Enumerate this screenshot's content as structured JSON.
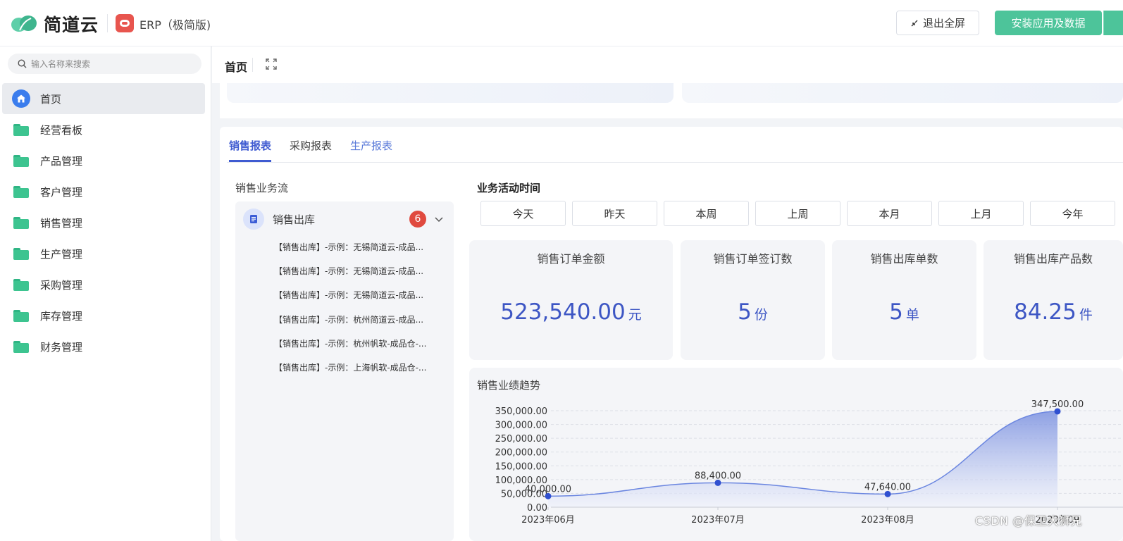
{
  "brand": {
    "name": "简道云",
    "app_name": "ERP（极简版)"
  },
  "header": {
    "exit_fullscreen_label": "退出全屏",
    "install_label": "安装应用及数据"
  },
  "sidebar": {
    "search_placeholder": "输入名称来搜索",
    "items": [
      {
        "label": "首页",
        "icon": "home-icon",
        "active": true
      },
      {
        "label": "经营看板",
        "icon": "folder-icon"
      },
      {
        "label": "产品管理",
        "icon": "folder-icon"
      },
      {
        "label": "客户管理",
        "icon": "folder-icon"
      },
      {
        "label": "销售管理",
        "icon": "folder-icon"
      },
      {
        "label": "生产管理",
        "icon": "folder-icon"
      },
      {
        "label": "采购管理",
        "icon": "folder-icon"
      },
      {
        "label": "库存管理",
        "icon": "folder-icon"
      },
      {
        "label": "财务管理",
        "icon": "folder-icon"
      }
    ]
  },
  "page": {
    "breadcrumb": "首页"
  },
  "tabs": [
    {
      "label": "销售报表",
      "active": true
    },
    {
      "label": "采购报表"
    },
    {
      "label": "生产报表"
    }
  ],
  "flow": {
    "title": "销售业务流",
    "node_name": "销售出库",
    "badge_count": "6",
    "items": [
      "【销售出库】-示例：无锡简道云-成品...",
      "【销售出库】-示例：无锡简道云-成品...",
      "【销售出库】-示例：无锡简道云-成品...",
      "【销售出库】-示例：杭州简道云-成品...",
      "【销售出库】-示例：杭州帆软-成品仓-...",
      "【销售出库】-示例：上海帆软-成品仓-..."
    ]
  },
  "activity": {
    "title": "业务活动时间",
    "periods": [
      "今天",
      "昨天",
      "本周",
      "上周",
      "本月",
      "上月",
      "今年"
    ]
  },
  "kpis": [
    {
      "label": "销售订单金额",
      "value": "523,540.00",
      "unit": "元"
    },
    {
      "label": "销售订单签订数",
      "value": "5",
      "unit": "份"
    },
    {
      "label": "销售出库单数",
      "value": "5",
      "unit": "单"
    },
    {
      "label": "销售出库产品数",
      "value": "84.25",
      "unit": "件"
    }
  ],
  "trend": {
    "title": "销售业绩趋势"
  },
  "chart_data": {
    "type": "area",
    "title": "销售业绩趋势",
    "categories": [
      "2023年06月",
      "2023年07月",
      "2023年08月",
      "2023年09月"
    ],
    "values": [
      40000,
      88400,
      47640,
      347500
    ],
    "data_labels": [
      "40,000.00",
      "88,400.00",
      "47,640.00",
      "347,500.00"
    ],
    "x_tick_labels": [
      "2023年06月",
      "2023年07月",
      "2023年08月",
      "2023年09"
    ],
    "ylim": [
      0,
      350000
    ],
    "y_ticks": [
      0,
      50000,
      100000,
      150000,
      200000,
      250000,
      300000,
      350000
    ],
    "y_tick_labels": [
      "0.00",
      "50,000.00",
      "100,000.00",
      "150,000.00",
      "200,000.00",
      "250,000.00",
      "300,000.00",
      "350,000.00"
    ],
    "grid": true,
    "colors": {
      "line": "#6b86e0",
      "point": "#3050d0",
      "fill_top": "#7b91e0",
      "fill_bottom": "#eef1fb"
    }
  },
  "watermark": "CSDN @保卫大狮兄"
}
